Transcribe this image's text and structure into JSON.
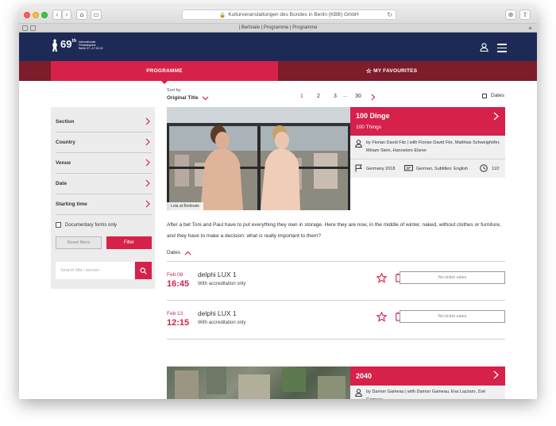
{
  "browser": {
    "url": "Kulturveranstaltungen des Bundes in Berlin (KBB) GmbH",
    "tab_title": "| Berlinale | Programme | Programme"
  },
  "header": {
    "logo_number": "69",
    "logo_superscript": "th",
    "logo_text_line1": "Internationale",
    "logo_text_line2": "Filmfestspiele",
    "logo_text_line3": "Berlin 07.–17.02.19"
  },
  "nav": {
    "programme": "PROGRAMME",
    "favourites": "MY FAVOURITES"
  },
  "sidebar": {
    "filters": [
      "Section",
      "Country",
      "Venue",
      "Date",
      "Starting time"
    ],
    "documentary_label": "Documentary forms only",
    "reset_label": "Reset filters",
    "filter_label": "Filter",
    "search_placeholder": "Search title / person"
  },
  "sort": {
    "label": "Sort by:",
    "value": "Original Title"
  },
  "pagination": {
    "pages": [
      "1",
      "2",
      "3",
      "...",
      "30"
    ],
    "active": "1"
  },
  "dates_toggle": "Dates",
  "film": {
    "title": "100 Dinge",
    "subtitle": "100 Things",
    "image_caption": "Lola at Berlinale",
    "credits": "by Florian David Fitz | with Florian David Fitz, Matthias Schweighöfer, Miriam Stein, Hannelore Elsner",
    "country_year": "Germany 2018",
    "languages": "German, Subtitles: English",
    "duration": "110'",
    "description": "After a bet Toni and Paul have to put everything they own in storage. Here they are now, in the middle of winter, naked, without clothes or furniture, and they have to make a decision: what is really important to them?",
    "dates_label": "Dates",
    "screenings": [
      {
        "date": "Feb 08",
        "time": "16:45",
        "venue": "delphi LUX 1",
        "note": "With accreditation only",
        "ticket": "No ticket sales"
      },
      {
        "date": "Feb 13",
        "time": "12:15",
        "venue": "delphi LUX 1",
        "note": "With accreditation only",
        "ticket": "No ticket sales"
      }
    ]
  },
  "film2": {
    "title": "2040",
    "credits": "by Damon Gameau | with Damon Gameau, Eva Lazzaro, Zoë Gameau"
  },
  "colors": {
    "brand_red": "#d6214a",
    "dark_red": "#7d1c2a",
    "navy": "#1e2a56"
  }
}
